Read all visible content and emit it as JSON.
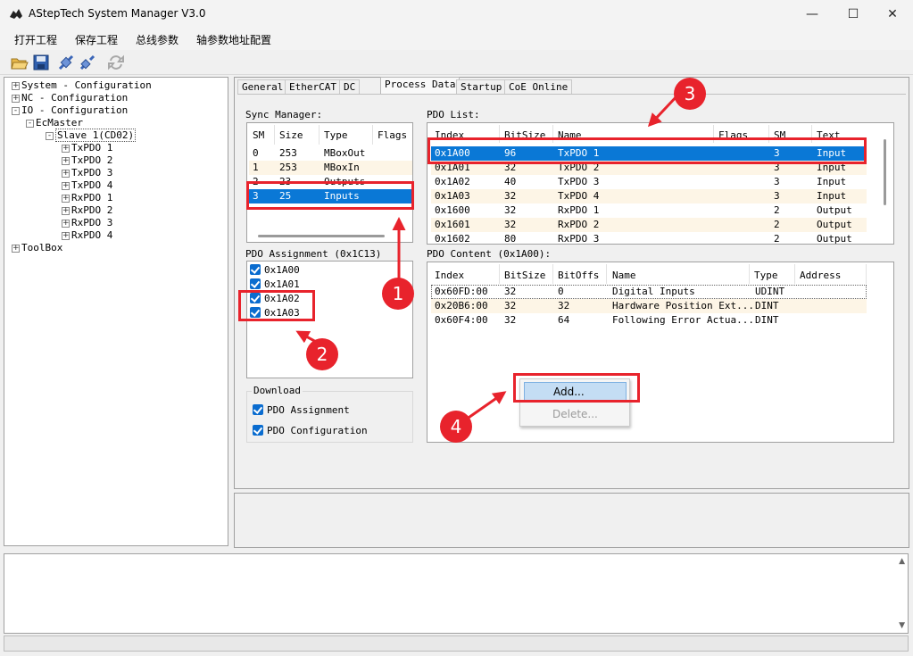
{
  "window": {
    "title": "AStepTech System Manager V3.0"
  },
  "menu": [
    "打开工程",
    "保存工程",
    "总线参数",
    "轴参数地址配置"
  ],
  "tree": [
    {
      "label": "System - Configuration",
      "exp": "+"
    },
    {
      "label": "NC - Configuration",
      "exp": "+"
    },
    {
      "label": "IO - Configuration",
      "exp": "-"
    },
    {
      "label": "EcMaster",
      "exp": "-"
    },
    {
      "label": "Slave 1(CD02)",
      "exp": "-"
    },
    {
      "label": "TxPDO 1",
      "exp": "+"
    },
    {
      "label": "TxPDO 2",
      "exp": "+"
    },
    {
      "label": "TxPDO 3",
      "exp": "+"
    },
    {
      "label": "TxPDO 4",
      "exp": "+"
    },
    {
      "label": "RxPDO 1",
      "exp": "+"
    },
    {
      "label": "RxPDO 2",
      "exp": "+"
    },
    {
      "label": "RxPDO 3",
      "exp": "+"
    },
    {
      "label": "RxPDO 4",
      "exp": "+"
    },
    {
      "label": "ToolBox",
      "exp": "+"
    }
  ],
  "tabs": [
    "General",
    "EtherCAT",
    "DC",
    "Process Data",
    "Startup",
    "CoE Online"
  ],
  "sync_manager": {
    "label": "Sync Manager:",
    "headers": [
      "SM",
      "Size",
      "Type",
      "Flags"
    ],
    "rows": [
      [
        "0",
        "253",
        "MBoxOut",
        ""
      ],
      [
        "1",
        "253",
        "MBoxIn",
        ""
      ],
      [
        "2",
        "23",
        "Outputs",
        ""
      ],
      [
        "3",
        "25",
        "Inputs",
        ""
      ]
    ]
  },
  "pdo_list": {
    "label": "PDO List:",
    "headers": [
      "Index",
      "BitSize",
      "Name",
      "Flags",
      "SM",
      "Text"
    ],
    "rows": [
      [
        "0x1A00",
        "96",
        "TxPDO 1",
        "",
        "3",
        "Input"
      ],
      [
        "0x1A01",
        "32",
        "TxPDO 2",
        "",
        "3",
        "Input"
      ],
      [
        "0x1A02",
        "40",
        "TxPDO 3",
        "",
        "3",
        "Input"
      ],
      [
        "0x1A03",
        "32",
        "TxPDO 4",
        "",
        "3",
        "Input"
      ],
      [
        "0x1600",
        "32",
        "RxPDO 1",
        "",
        "2",
        "Output"
      ],
      [
        "0x1601",
        "32",
        "RxPDO 2",
        "",
        "2",
        "Output"
      ],
      [
        "0x1602",
        "80",
        "RxPDO 3",
        "",
        "2",
        "Output"
      ]
    ]
  },
  "pdo_assignment": {
    "label": "PDO Assignment (0x1C13)",
    "items": [
      "0x1A00",
      "0x1A01",
      "0x1A02",
      "0x1A03"
    ]
  },
  "pdo_content": {
    "label": "PDO Content (0x1A00):",
    "headers": [
      "Index",
      "BitSize",
      "BitOffs",
      "Name",
      "Type",
      "Address"
    ],
    "rows": [
      [
        "0x60FD:00",
        "32",
        "0",
        "Digital Inputs",
        "UDINT",
        ""
      ],
      [
        "0x20B6:00",
        "32",
        "32",
        "Hardware Position Ext...",
        "DINT",
        ""
      ],
      [
        "0x60F4:00",
        "32",
        "64",
        "Following Error Actua...",
        "DINT",
        ""
      ]
    ]
  },
  "download": {
    "label": "Download",
    "items": [
      "PDO Assignment",
      "PDO Configuration"
    ]
  },
  "context_menu": {
    "add": "Add...",
    "delete": "Delete..."
  },
  "badges": [
    "1",
    "2",
    "3",
    "4"
  ],
  "colors": {
    "selection": "#0a78d6",
    "annotation": "#e8232c",
    "checkbox": "#0a6ccf"
  }
}
